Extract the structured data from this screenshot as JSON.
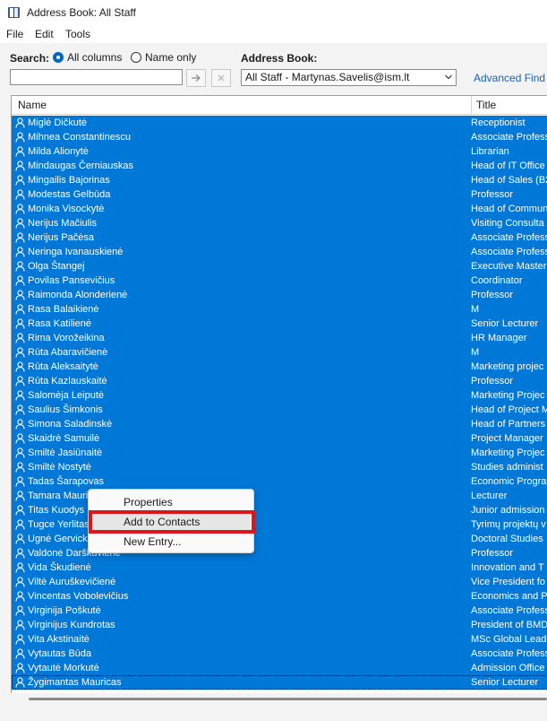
{
  "window": {
    "title": "Address Book: All Staff",
    "icon": "address-book-icon"
  },
  "menu": [
    "File",
    "Edit",
    "Tools"
  ],
  "search": {
    "label": "Search:",
    "options": [
      "All columns",
      "Name only"
    ],
    "selected": "All columns",
    "value": "",
    "go_icon": "arrow-right-icon",
    "clear_icon": "close-icon"
  },
  "address_book": {
    "label": "Address Book:",
    "selected": "All Staff - Martynas.Savelis@ism.lt",
    "advanced_find": "Advanced Find"
  },
  "table": {
    "columns": [
      "Name",
      "Title"
    ],
    "rows": [
      {
        "name": "Miglė Dičkutė",
        "title": "Receptionist"
      },
      {
        "name": "Mihnea Constantinescu",
        "title": "Associate Profess"
      },
      {
        "name": "Milda Alionytė",
        "title": "Librarian"
      },
      {
        "name": "Mindaugas Černiauskas",
        "title": "Head of IT Office"
      },
      {
        "name": "Mingailis Bajorinas",
        "title": "Head of Sales (B2"
      },
      {
        "name": "Modestas Gelbūda",
        "title": "Professor"
      },
      {
        "name": "Monika Visockytė",
        "title": "Head of Commun"
      },
      {
        "name": "Nerijus Mačiulis",
        "title": "Visiting Consulta"
      },
      {
        "name": "Nerijus Pačėsa",
        "title": "Associate Profess"
      },
      {
        "name": "Neringa Ivanauskienė",
        "title": "Associate Profess"
      },
      {
        "name": "Olga Štangej",
        "title": "Executive Master"
      },
      {
        "name": "Povilas Pansevičius",
        "title": "Coordinator"
      },
      {
        "name": "Raimonda Alonderienė",
        "title": "Professor"
      },
      {
        "name": "Rasa Balaikienė",
        "title": "M"
      },
      {
        "name": "Rasa Katilienė",
        "title": "Senior Lecturer"
      },
      {
        "name": "Rima Vorožeikina",
        "title": "HR Manager"
      },
      {
        "name": "Rūta Abaravičienė",
        "title": "M"
      },
      {
        "name": "Rūta Aleksaitytė",
        "title": "Marketing projec"
      },
      {
        "name": "Rūta Kazlauskaitė",
        "title": "Professor"
      },
      {
        "name": "Salomėja Leiputė",
        "title": "Marketing Projec"
      },
      {
        "name": "Saulius Šimkonis",
        "title": "Head of Project M"
      },
      {
        "name": "Simona Saladinskė",
        "title": "Head of Partners"
      },
      {
        "name": "Skaidrė Samuilė",
        "title": "Project Manager"
      },
      {
        "name": "Smiltė Jasiūnaitė",
        "title": "Marketing Projec"
      },
      {
        "name": "Smiltė Nostytė",
        "title": "Studies administ"
      },
      {
        "name": "Tadas Šarapovas",
        "title": "Economic Progra"
      },
      {
        "name": "Tamara Mauri",
        "title": "Lecturer"
      },
      {
        "name": "Titas Kuodys",
        "title": "Junior admission"
      },
      {
        "name": "Tugce Yerlitas",
        "title": "Tyrimų projektų v"
      },
      {
        "name": "Ugnė Gervicka",
        "title": "Doctoral Studies"
      },
      {
        "name": "Valdonė Darškuvienė",
        "title": "Professor"
      },
      {
        "name": "Vida Škudienė",
        "title": "Innovation and T"
      },
      {
        "name": "Viltė Auruškevičienė",
        "title": "Vice President fo"
      },
      {
        "name": "Vincentas Vobolevičius",
        "title": "Economics and P"
      },
      {
        "name": "Virginija Poškutė",
        "title": "Associate Profess"
      },
      {
        "name": "Virginijus Kundrotas",
        "title": "President of BMD"
      },
      {
        "name": "Vita Akstinaitė",
        "title": "MSc Global Lead"
      },
      {
        "name": "Vytautas Būda",
        "title": "Associate Profess"
      },
      {
        "name": "Vytautė Morkutė",
        "title": "Admission Office"
      },
      {
        "name": "Žygimantas Mauricas",
        "title": "Senior Lecturer"
      }
    ]
  },
  "context_menu": {
    "items": [
      "Properties",
      "Add to Contacts",
      "New Entry..."
    ],
    "highlighted": "Add to Contacts"
  },
  "colors": {
    "selection": "#0078d7",
    "highlight_box": "#e0141b",
    "link": "#1663b5"
  }
}
